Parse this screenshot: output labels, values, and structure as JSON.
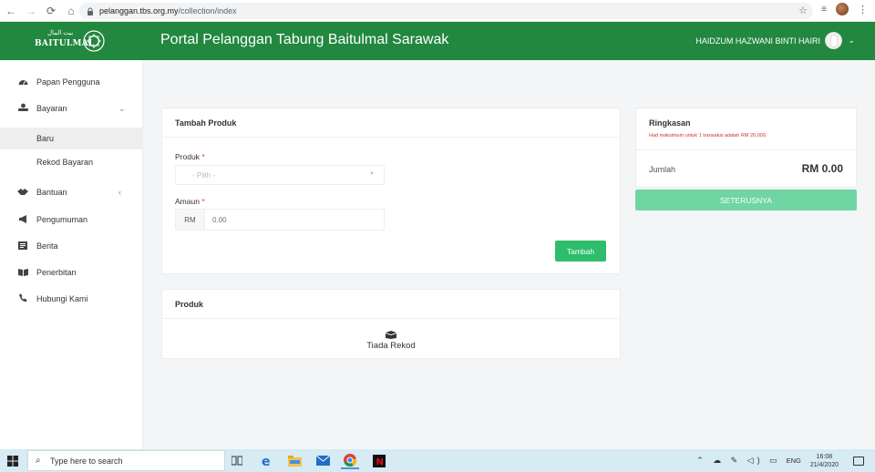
{
  "browser": {
    "url_host": "pelanggan.tbs.org.my",
    "url_path": "/collection/index"
  },
  "header": {
    "logo_text": "BAITULMAL",
    "logo_arabic": "بيت المال",
    "title": "Portal Pelanggan Tabung Baitulmal Sarawak",
    "user_name": "HAIDZUM HAZWANI BINTI HAIRI"
  },
  "sidebar": {
    "items": [
      {
        "label": "Papan Pengguna",
        "icon": "dashboard-icon"
      },
      {
        "label": "Bayaran",
        "icon": "payment-icon"
      },
      {
        "label": "Baru"
      },
      {
        "label": "Rekod Bayaran"
      },
      {
        "label": "Bantuan",
        "icon": "handshake-icon"
      },
      {
        "label": "Pengumuman",
        "icon": "megaphone-icon"
      },
      {
        "label": "Berita",
        "icon": "newspaper-icon"
      },
      {
        "label": "Penerbitan",
        "icon": "book-icon"
      },
      {
        "label": "Hubungi Kami",
        "icon": "phone-icon"
      }
    ]
  },
  "form": {
    "title": "Tambah Produk",
    "produk_label": "Produk",
    "produk_placeholder": "- Pilih -",
    "amaun_label": "Amaun",
    "currency": "RM",
    "amount_placeholder": "0.00",
    "submit_label": "Tambah",
    "required_mark": "*"
  },
  "product_list": {
    "title": "Produk",
    "empty_text": "Tiada Rekod"
  },
  "summary": {
    "title": "Ringkasan",
    "warning": "Had maksimum untuk 1 transaksi adalah RM 20,000.",
    "total_label": "Jumlah",
    "total_value": "RM 0.00",
    "next_label": "SETERUSNYA"
  },
  "taskbar": {
    "search_placeholder": "Type here to search",
    "lang": "ENG",
    "time": "16:08",
    "date": "21/4/2020"
  },
  "colors": {
    "header_green": "#22873f",
    "button_green": "#2ebd6b",
    "button_disabled_green": "#6fd5a3",
    "warning_red": "#d32f2f"
  }
}
